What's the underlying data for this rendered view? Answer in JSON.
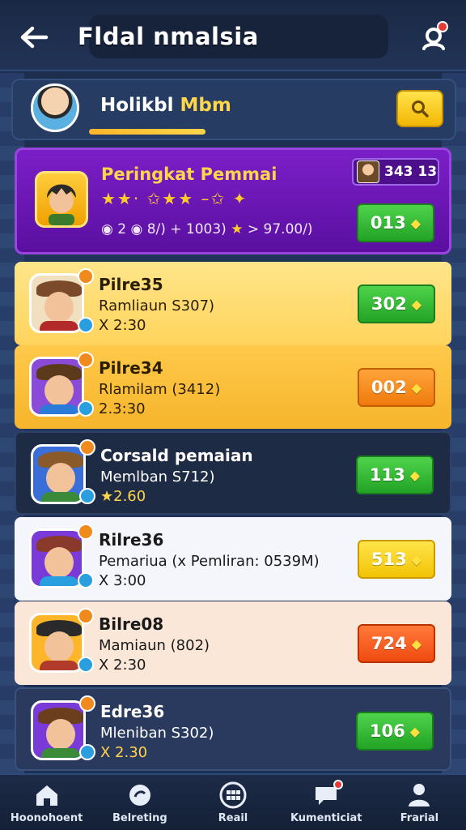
{
  "header": {
    "title": "Fldal nmalsia",
    "back_icon": "arrow-left-icon",
    "notification_icon": "user-group-icon"
  },
  "profile": {
    "name_part1": "Holikbl ",
    "name_part2": "Mbm",
    "progress_percent": 100,
    "search_icon": "search-icon"
  },
  "rank_card": {
    "title": "Peringkat Pemmai",
    "stars": "★★· ✩★★ –✩ ✦",
    "stats": "◉ 2  ◉ 8/)  + 1003)  ",
    "stats_star": "★",
    "stats_end": " > 97.00/)",
    "badge_value": "343 13",
    "action_label": "013"
  },
  "players": [
    {
      "name": "Pilre35",
      "detail": "Ramliaun S307)",
      "time": "X 2:30",
      "action": "302",
      "color": "green"
    },
    {
      "name": "Pilre34",
      "detail": "Rlamilam (3412)",
      "time": "2.3:30",
      "action": "002",
      "color": "orange"
    },
    {
      "name": "Corsald pemaian",
      "detail": "Memlban S712)",
      "time": "★2.60",
      "action": "113",
      "color": "green"
    },
    {
      "name": "Rilre36",
      "detail": "Pemariua (x Pemliran: 0539M)",
      "time": "X 3:00",
      "action": "513",
      "color": "yellow"
    },
    {
      "name": "Bilre08",
      "detail": "Mamiaun (802)",
      "time": "X 2:30",
      "action": "724",
      "color": "red"
    },
    {
      "name": "Edre36",
      "detail": "Mleniban S302)",
      "time": "X 2.30",
      "action": "106",
      "color": "green"
    }
  ],
  "nav": [
    {
      "label": "Hoonohoent",
      "icon": "home-icon"
    },
    {
      "label": "Belreting",
      "icon": "hand-icon"
    },
    {
      "label": "Reail",
      "icon": "grid-icon"
    },
    {
      "label": "Kumenticiat",
      "icon": "chat-icon"
    },
    {
      "label": "Frarial",
      "icon": "profile-icon"
    }
  ]
}
